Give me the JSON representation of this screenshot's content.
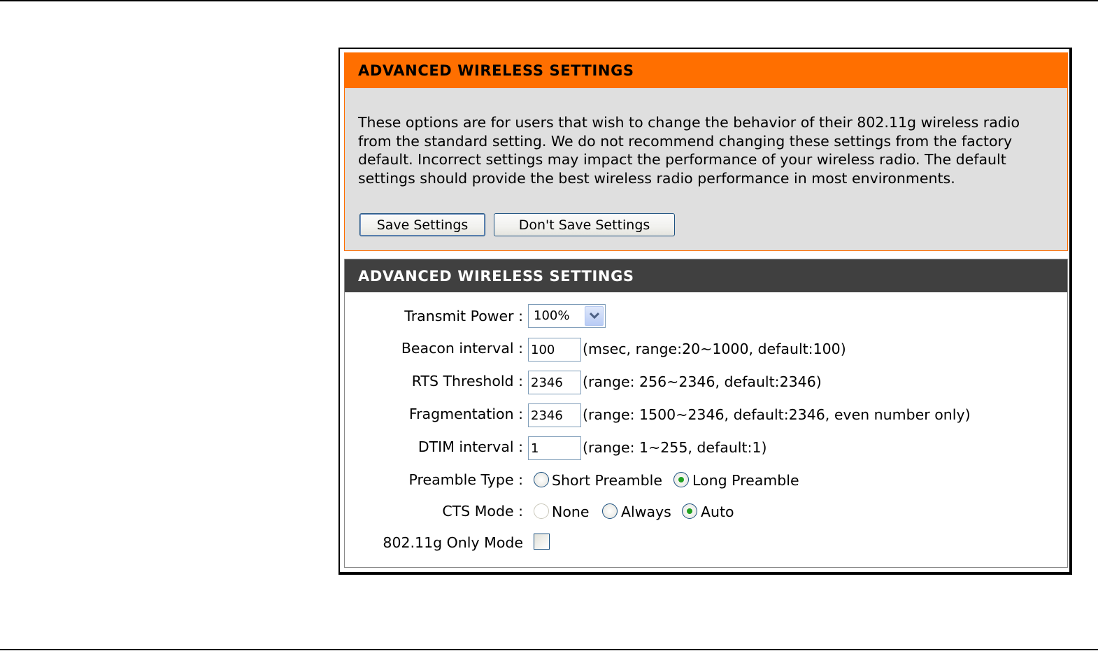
{
  "intro": {
    "title": "ADVANCED WIRELESS SETTINGS",
    "description": "These options are for users that wish to change the behavior of their 802.11g wireless radio from the standard setting. We do not recommend changing these settings from the factory default. Incorrect settings may impact the performance of your wireless radio. The default settings should provide the best wireless radio performance in most environments.",
    "save_button": "Save Settings",
    "dont_save_button": "Don't Save Settings"
  },
  "settings": {
    "title": "ADVANCED WIRELESS SETTINGS",
    "transmit_power": {
      "label": "Transmit Power :",
      "value": "100%"
    },
    "beacon_interval": {
      "label": "Beacon interval :",
      "value": "100",
      "hint": "(msec, range:20~1000, default:100)"
    },
    "rts_threshold": {
      "label": "RTS Threshold :",
      "value": "2346",
      "hint": "(range: 256~2346, default:2346)"
    },
    "fragmentation": {
      "label": "Fragmentation :",
      "value": "2346",
      "hint": "(range: 1500~2346, default:2346, even number only)"
    },
    "dtim_interval": {
      "label": "DTIM interval :",
      "value": "1",
      "hint": "(range: 1~255, default:1)"
    },
    "preamble_type": {
      "label": "Preamble Type :",
      "options": [
        "Short Preamble",
        "Long Preamble"
      ],
      "selected": "Long Preamble"
    },
    "cts_mode": {
      "label": "CTS Mode :",
      "options": [
        "None",
        "Always",
        "Auto"
      ],
      "selected": "Auto"
    },
    "g_only_mode": {
      "label": "802.11g Only Mode",
      "checked": false
    }
  },
  "colors": {
    "orange_header": "#ff6f00",
    "dark_header": "#404040",
    "intro_background": "#dfdfdf",
    "radio_selected": "#21a121"
  },
  "icons": {
    "select_arrow": "chevron-down-icon"
  }
}
